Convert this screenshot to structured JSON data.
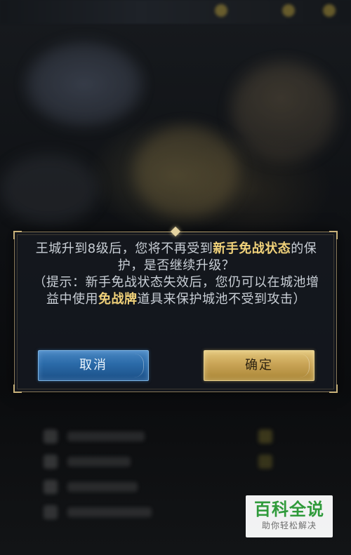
{
  "dialog": {
    "message": {
      "part1": "王城升到8级后，您将不再受到",
      "highlight1": "新手免战状态",
      "part2": "的保护，是否继续升级？",
      "hint_part1": "（提示：新手免战状态失效后，您仍可以在城池增益中使用",
      "highlight2": "免战牌",
      "hint_part2": "道具来保护城池不受到攻击）"
    },
    "cancel_label": "取消",
    "confirm_label": "确定"
  },
  "watermark": {
    "title": "百科全说",
    "subtitle": "助你轻松解决"
  },
  "colors": {
    "highlight": "#f1d27a",
    "cancel_button": "#2a6aa8",
    "confirm_button": "#c9a456",
    "watermark_green": "#2f9a3a"
  }
}
